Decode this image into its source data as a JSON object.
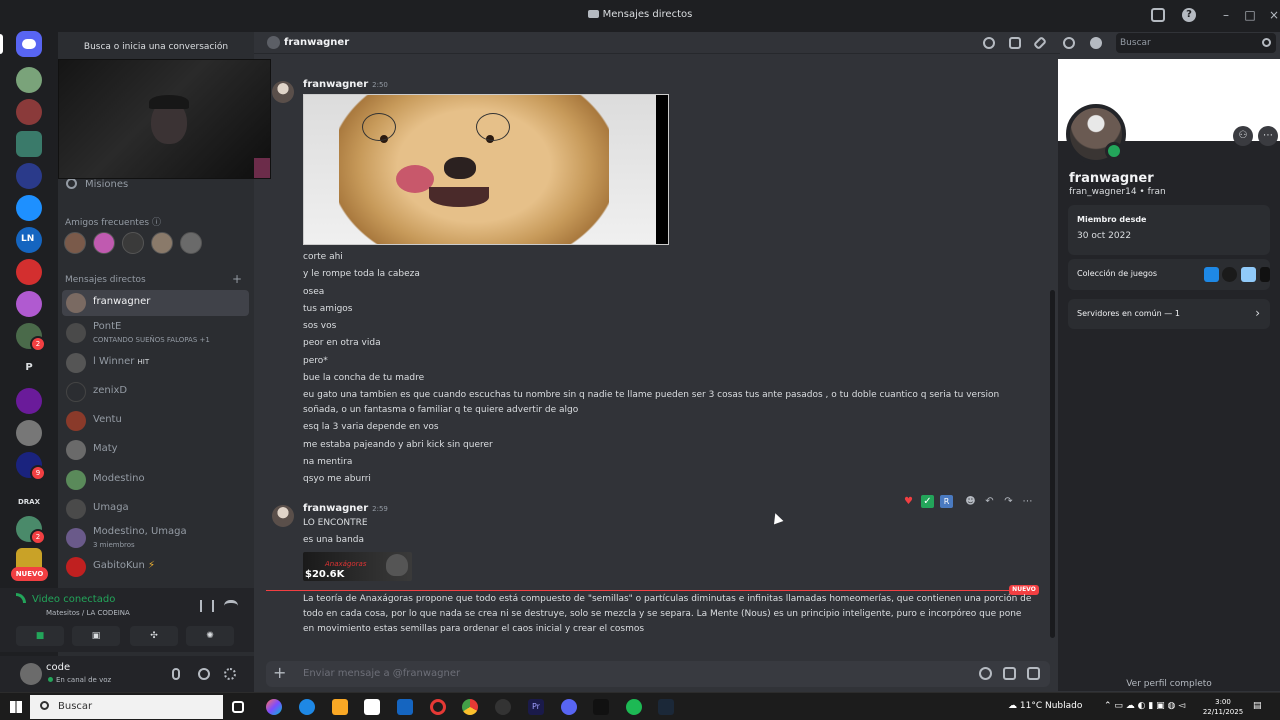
{
  "window": {
    "title": "Mensajes directos"
  },
  "servers": {
    "icons": [
      "discord-home-icon",
      "server-1",
      "server-2",
      "server-3",
      "server-4",
      "server-5",
      "server-6",
      "server-7",
      "server-8",
      "server-9",
      "server-10",
      "server-11",
      "server-12",
      "server-13",
      "server-14",
      "server-15",
      "server-16",
      "server-17"
    ],
    "text_items": [
      "P",
      "DRAX"
    ],
    "badges": [
      "2",
      "9",
      "2"
    ],
    "new_label": "NUEVO",
    "colors": {
      "home": "#5865f2",
      "badge": "#f23f42"
    }
  },
  "dm_sidebar": {
    "search_placeholder": "Busca o inicia una conversación",
    "missions": "Misiones",
    "frequent_friends_label": "Amigos frecuentes",
    "direct_messages_label": "Mensajes directos",
    "add": "+",
    "items": [
      {
        "name": "franwagner",
        "sub": ""
      },
      {
        "name": "PontE",
        "sub": "CONTANDO SUEÑOS FALOPAS +1"
      },
      {
        "name": "l Winner",
        "sub": "",
        "tag": "HIT"
      },
      {
        "name": "zenixD",
        "sub": ""
      },
      {
        "name": "Ventu",
        "sub": ""
      },
      {
        "name": "Maty",
        "sub": ""
      },
      {
        "name": "Modestino",
        "sub": ""
      },
      {
        "name": "Umaga",
        "sub": ""
      },
      {
        "name": "Modestino, Umaga",
        "sub": "3 miembros"
      },
      {
        "name": "GabitoKun",
        "sub": "",
        "tag": "⚡"
      }
    ]
  },
  "voice": {
    "status": "Video conectado",
    "channel": "Matesitos / LA CODEINA"
  },
  "user": {
    "name": "code",
    "status": "En canal de voz"
  },
  "chat": {
    "recipient": "franwagner",
    "search_placeholder": "Buscar",
    "composer_placeholder": "Enviar mensaje a @franwagner",
    "new_tag": "NUEVO",
    "messages": [
      {
        "author": "franwagner",
        "time": "2:50",
        "lines": [
          "corte ahi",
          "y le rompe toda la cabeza",
          "osea",
          "tus amigos",
          "sos vos",
          "peor en otra vida",
          "pero*",
          "bue la concha de tu madre",
          "eu gato una tambien es que cuando escuchas tu nombre sin q nadie te llame pueden ser 3 cosas tus ante pasados , o tu doble cuantico q seria tu version soñada, o un fantasma o familiar q te quiere advertir de algo",
          "esq la 3 varia depende en vos",
          "me estaba pajeando y abri kick sin querer",
          "na mentira",
          "qsyo me aburri"
        ]
      },
      {
        "author": "franwagner",
        "time": "2:59",
        "lines": [
          "LO ENCONTRE",
          "es una banda",
          "La teoría de Anaxágoras propone que todo está compuesto de \"semillas\" o partículas diminutas e infinitas llamadas homeomerías, que contienen una porción de todo en cada cosa, por lo que nada se crea ni se destruye, solo se mezcla y se separa. La Mente (Nous) es un principio inteligente, puro e incorpóreo que pone en movimiento estas semillas para ordenar el caos inicial y crear el cosmos"
        ],
        "attachment": {
          "brand": "Anaxágoras",
          "value": "$20.6K"
        }
      }
    ]
  },
  "profile": {
    "name": "franwagner",
    "username": "fran_wagner14 • fran",
    "member_since_label": "Miembro desde",
    "member_since": "30 oct 2022",
    "games_label": "Colección de juegos",
    "mutual_servers": "Servidores en común — 1",
    "view_full": "Ver perfil completo"
  },
  "taskbar": {
    "search": "Buscar",
    "weather": "11°C  Nublado",
    "time": "3:00",
    "date": "22/11/2025"
  }
}
